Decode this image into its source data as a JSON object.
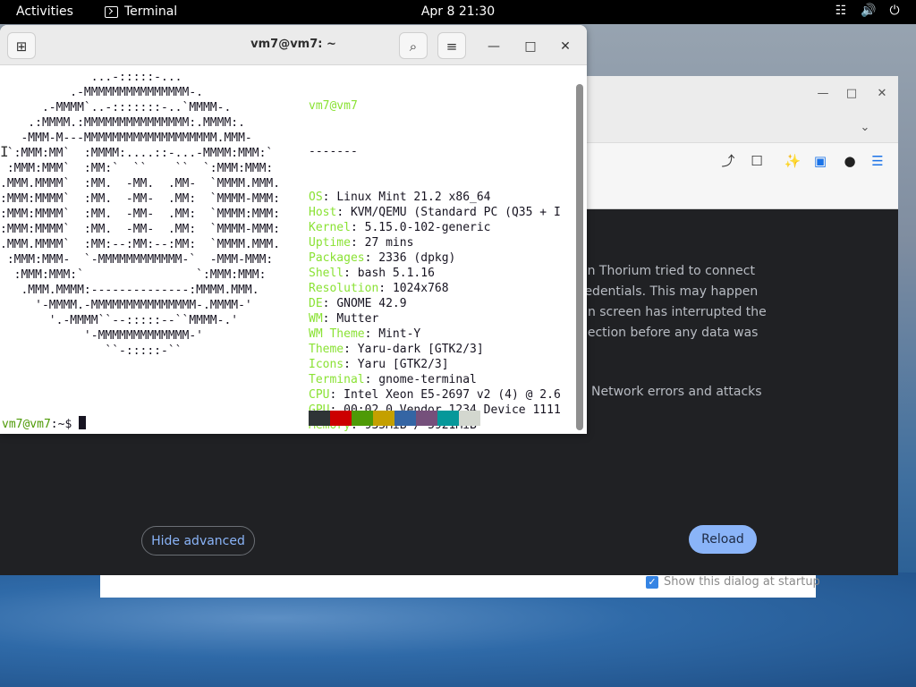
{
  "topbar": {
    "activities": "Activities",
    "app_name": "Terminal",
    "clock": "Apr 8  21:30",
    "network_icon": "network-icon",
    "volume_icon": "volume-icon",
    "power_icon": "power-icon"
  },
  "terminal": {
    "title": "vm7@vm7: ~",
    "ascii_lines": [
      "             ...-:::::-...",
      "          .-MMMMMMMMMMMMMMM-.",
      "      .-MMMM`..-:::::::-..`MMMM-.",
      "    .:MMMM.:MMMMMMMMMMMMMMM:.MMMM:.",
      "   -MMM-M---MMMMMMMMMMMMMMMMMMM.MMM-",
      " `:MMM:MM`  :MMMM:....::-...-MMMM:MMM:`",
      " :MMM:MMM`  :MM:`  ``    ``  `:MMM:MMM:",
      ".MMM.MMMM`  :MM.  -MM.  .MM-  `MMMM.MMM.",
      ":MMM:MMMM`  :MM.  -MM-  .MM:  `MMMM-MMM:",
      ":MMM:MMMM`  :MM.  -MM-  .MM:  `MMMM:MMM:",
      ":MMM:MMMM`  :MM.  -MM-  .MM:  `MMMM-MMM:",
      ".MMM.MMMM`  :MM:--:MM:--:MM:  `MMMM.MMM.",
      " :MMM:MMM-  `-MMMMMMMMMMMM-`  -MMM-MMM:",
      "  :MMM:MMM:`                `:MMM:MMM:",
      "   .MMM.MMMM:--------------:MMMM.MMM.",
      "     '-MMMM.-MMMMMMMMMMMMMMM-.MMMM-'",
      "       '.-MMMM``--:::::--``MMMM-.'",
      "            '-MMMMMMMMMMMMM-'",
      "               ``-:::::-``"
    ],
    "user_host": "vm7@vm7",
    "separator": "-------",
    "info": [
      {
        "key": "OS",
        "value": "Linux Mint 21.2 x86_64"
      },
      {
        "key": "Host",
        "value": "KVM/QEMU (Standard PC (Q35 + I"
      },
      {
        "key": "Kernel",
        "value": "5.15.0-102-generic"
      },
      {
        "key": "Uptime",
        "value": "27 mins"
      },
      {
        "key": "Packages",
        "value": "2336 (dpkg)"
      },
      {
        "key": "Shell",
        "value": "bash 5.1.16"
      },
      {
        "key": "Resolution",
        "value": "1024x768"
      },
      {
        "key": "DE",
        "value": "GNOME 42.9"
      },
      {
        "key": "WM",
        "value": "Mutter"
      },
      {
        "key": "WM Theme",
        "value": "Mint-Y"
      },
      {
        "key": "Theme",
        "value": "Yaru-dark [GTK2/3]"
      },
      {
        "key": "Icons",
        "value": "Yaru [GTK2/3]"
      },
      {
        "key": "Terminal",
        "value": "gnome-terminal"
      },
      {
        "key": "CPU",
        "value": "Intel Xeon E5-2697 v2 (4) @ 2.6"
      },
      {
        "key": "GPU",
        "value": "00:02.0 Vendor 1234 Device 1111"
      },
      {
        "key": "Memory",
        "value": "935MiB / 5921MiB"
      }
    ],
    "palette_top": [
      "#2e3436",
      "#cc0000",
      "#4e9a06",
      "#c4a000",
      "#3465a4",
      "#75507b",
      "#06989a",
      "#d3d7cf"
    ],
    "palette_bottom": [
      "#555753",
      "#ef2929",
      "#8ae234",
      "#fce94f",
      "#729fcf",
      "#ad7fa8",
      "#34e2e2",
      "#eeeeec"
    ],
    "prompt_user": "vm7@vm7",
    "prompt_suffix": ":~$ "
  },
  "browser": {
    "page_lines": [
      "en Thorium tried to connect",
      "redentials. This may happen",
      "-in screen has interrupted the",
      "nection before any data was"
    ],
    "network_errors": "Network errors and attacks",
    "hide_advanced": "Hide advanced",
    "reload": "Reload"
  },
  "dialog": {
    "show_at_startup": "Show this dialog at startup"
  }
}
